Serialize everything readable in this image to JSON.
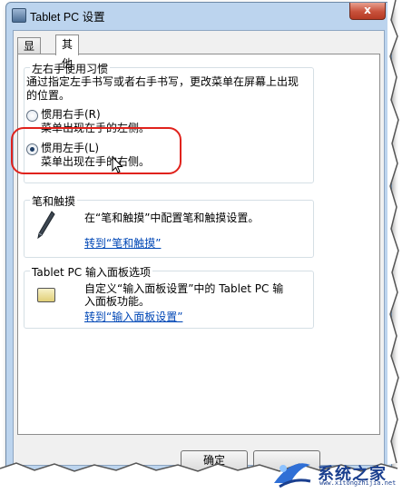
{
  "window": {
    "title": "Tablet PC 设置",
    "close_label": "x"
  },
  "tabs": [
    {
      "label": "显示",
      "active": false
    },
    {
      "label": "其他",
      "active": true
    }
  ],
  "handedness": {
    "group_title": "左右手使用习惯",
    "description_line1": "通过指定左手书写或者右手书写，更改菜单在屏幕上出现",
    "description_line2": "的位置。",
    "right_hand": {
      "label": "惯用右手(R)",
      "detail": "菜单出现在手的左侧。",
      "checked": false
    },
    "left_hand": {
      "label": "惯用左手(L)",
      "detail": "菜单出现在手的右侧。",
      "checked": true
    }
  },
  "pen": {
    "group_title": "笔和触摸",
    "description": "在“笔和触摸”中配置笔和触摸设置。",
    "link": "转到“笔和触摸”"
  },
  "input_panel": {
    "group_title": "Tablet PC 输入面板选项",
    "description_line1": "自定义“输入面板设置”中的 Tablet PC 输",
    "description_line2": "入面板功能。",
    "link": "转到“输入面板设置”"
  },
  "buttons": {
    "ok": "确定"
  },
  "watermark": {
    "text": "系统之家",
    "url": "www.xitongzhijia.net"
  },
  "colors": {
    "highlight": "#e0221c",
    "link": "#0047b6",
    "title_bar": "#bcd4ee"
  }
}
